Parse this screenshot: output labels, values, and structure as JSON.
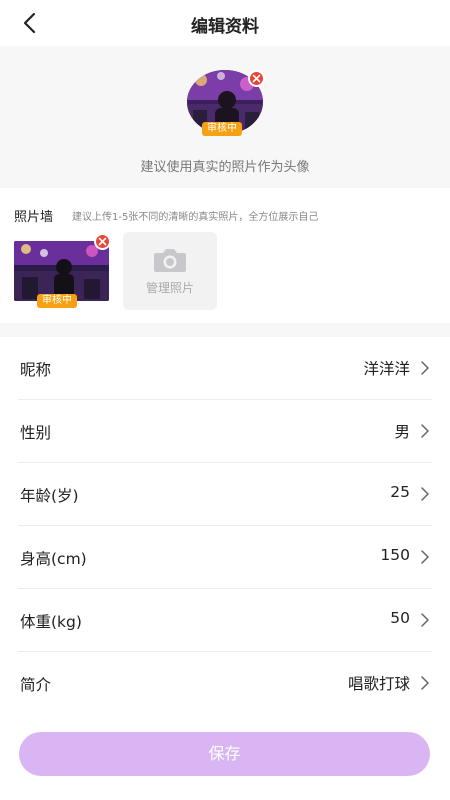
{
  "header": {
    "title": "编辑资料"
  },
  "avatar": {
    "status_tag": "审核中",
    "hint": "建议使用真实的照片作为头像"
  },
  "photo_wall": {
    "title": "照片墙",
    "tip": "建议上传1-5张不同的清晰的真实照片，全方位展示自己",
    "photos": [
      {
        "status_tag": "审核中"
      }
    ],
    "manage_label": "管理照片"
  },
  "fields": [
    {
      "label": "昵称",
      "value": "洋洋洋"
    },
    {
      "label": "性别",
      "value": "男"
    },
    {
      "label": "年龄(岁)",
      "value": "25"
    },
    {
      "label": "身高(cm)",
      "value": "150"
    },
    {
      "label": "体重(kg)",
      "value": "50"
    },
    {
      "label": "简介",
      "value": "唱歌打球"
    }
  ],
  "save_label": "保存",
  "colors": {
    "accent": "#d9b6f3",
    "review_tag": "#f6a013",
    "remove_badge": "#e9463a"
  }
}
